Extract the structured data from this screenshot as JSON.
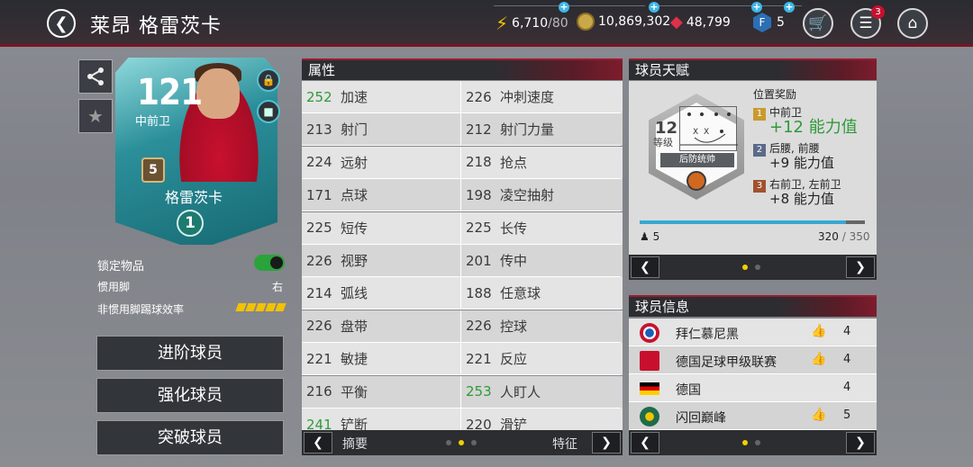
{
  "header": {
    "title": "莱昂 格雷茨卡",
    "energy": "6,710",
    "energy_max": "/80",
    "coins": "10,869,302",
    "gems": "48,799",
    "fifa_points": "5",
    "notification_badge": "3"
  },
  "player_card": {
    "rating": "121",
    "position": "中前卫",
    "rank": "5",
    "name": "格雷茨卡",
    "level": "1"
  },
  "left_info": {
    "lock_label": "锁定物品",
    "preferred_foot_label": "惯用脚",
    "preferred_foot_value": "右",
    "weak_foot_label": "非惯用脚踢球效率",
    "weak_foot_stars": 5
  },
  "buttons": {
    "advance": "进阶球员",
    "train": "强化球员",
    "breakthrough": "突破球员"
  },
  "attributes": {
    "title": "属性",
    "rows": [
      [
        {
          "v": "252",
          "n": "加速",
          "hi": true
        },
        {
          "v": "226",
          "n": "冲刺速度",
          "hi": false
        }
      ],
      [
        {
          "v": "213",
          "n": "射门",
          "hi": false
        },
        {
          "v": "212",
          "n": "射门力量",
          "hi": false
        }
      ],
      [
        {
          "v": "224",
          "n": "远射",
          "hi": false
        },
        {
          "v": "218",
          "n": "抢点",
          "hi": false
        }
      ],
      [
        {
          "v": "171",
          "n": "点球",
          "hi": false
        },
        {
          "v": "198",
          "n": "凌空抽射",
          "hi": false
        }
      ],
      [
        {
          "v": "225",
          "n": "短传",
          "hi": false
        },
        {
          "v": "225",
          "n": "长传",
          "hi": false
        }
      ],
      [
        {
          "v": "226",
          "n": "视野",
          "hi": false
        },
        {
          "v": "201",
          "n": "传中",
          "hi": false
        }
      ],
      [
        {
          "v": "214",
          "n": "弧线",
          "hi": false
        },
        {
          "v": "188",
          "n": "任意球",
          "hi": false
        }
      ],
      [
        {
          "v": "226",
          "n": "盘带",
          "hi": false
        },
        {
          "v": "226",
          "n": "控球",
          "hi": false
        }
      ],
      [
        {
          "v": "221",
          "n": "敏捷",
          "hi": false
        },
        {
          "v": "221",
          "n": "反应",
          "hi": false
        }
      ],
      [
        {
          "v": "216",
          "n": "平衡",
          "hi": false
        },
        {
          "v": "253",
          "n": "人盯人",
          "hi": true
        }
      ],
      [
        {
          "v": "241",
          "n": "铲断",
          "hi": true
        },
        {
          "v": "220",
          "n": "滑铲",
          "hi": false
        }
      ]
    ],
    "nav_left_label": "摘要",
    "nav_right_label": "特征"
  },
  "talent": {
    "title": "球员天赋",
    "level_num": "12",
    "level_label": "等级",
    "skill_name": "后防统帅",
    "pos_title": "位置奖励",
    "bonuses": [
      {
        "num": "1",
        "color": "#c99a2e",
        "pos": "中前卫",
        "val": "+12 能力值",
        "green": true
      },
      {
        "num": "2",
        "color": "#5a6a8a",
        "pos": "后腰, 前腰",
        "val": "+9 能力值",
        "green": false
      },
      {
        "num": "3",
        "color": "#a0522d",
        "pos": "右前卫, 左前卫",
        "val": "+8 能力值",
        "green": false
      }
    ],
    "points": "5",
    "progress_current": "320",
    "progress_max": "/ 350",
    "progress_fraction": 0.914
  },
  "player_info": {
    "title": "球员信息",
    "rows": [
      {
        "name": "拜仁慕尼黑",
        "rank": "4",
        "thumb": true,
        "icon": "bayern-icon"
      },
      {
        "name": "德国足球甲级联赛",
        "rank": "4",
        "thumb": true,
        "icon": "bundesliga-icon"
      },
      {
        "name": "德国",
        "rank": "4",
        "thumb": false,
        "icon": "germany-flag-icon"
      },
      {
        "name": "闪回巅峰",
        "rank": "5",
        "thumb": true,
        "icon": "flashback-icon"
      }
    ]
  }
}
